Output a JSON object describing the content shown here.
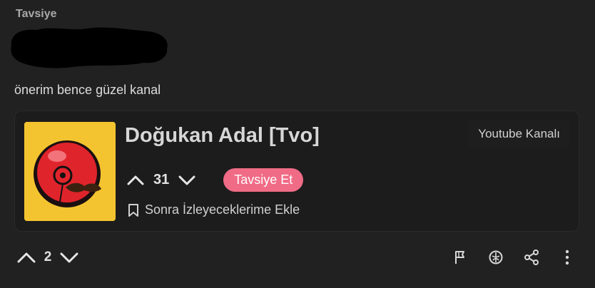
{
  "post": {
    "category": "Tavsiye",
    "comment": "önerim bence güzel kanal",
    "votes": "2"
  },
  "card": {
    "channel_name": "Doğukan Adal [Tvo]",
    "channel_type": "Youtube Kanalı",
    "votes": "31",
    "recommend_label": "Tavsiye Et",
    "watch_later_label": "Sonra İzleyeceklerime Ekle"
  },
  "icons": {
    "upvote": "chevron-up-icon",
    "downvote": "chevron-down-icon",
    "bookmark": "bookmark-icon",
    "report": "flag-icon",
    "award": "award-icon",
    "share": "share-icon",
    "more": "more-vertical-icon"
  },
  "colors": {
    "background": "#212121",
    "card_background": "#1c1c1c",
    "accent": "#f06b86",
    "thumbnail_background": "#f4c430"
  }
}
